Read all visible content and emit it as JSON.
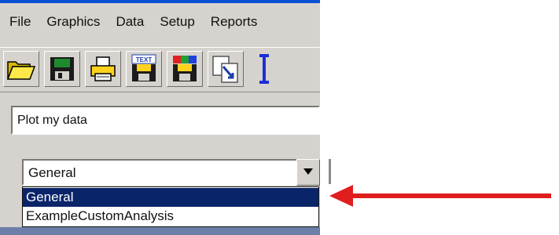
{
  "menu": [
    "File",
    "Graphics",
    "Data",
    "Setup",
    "Reports"
  ],
  "toolbar": {
    "icons": [
      "folder-open-icon",
      "save-disk-icon",
      "printer-icon",
      "export-text-icon",
      "export-color-icon",
      "copy-pages-icon",
      "text-cursor-icon"
    ],
    "text_badge": "TEXT"
  },
  "plot_text": {
    "value": "Plot my data"
  },
  "analysis_combo": {
    "selected": "General",
    "options": [
      "General",
      "ExampleCustomAnalysis"
    ]
  },
  "accent_colors": {
    "arrow": "#e01e1e",
    "selection": "#0a246a",
    "title_bar": "#0b4fd6"
  }
}
